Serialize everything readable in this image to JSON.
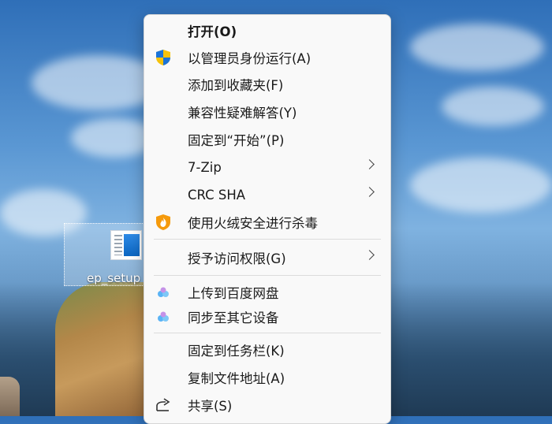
{
  "desktop": {
    "icon_label": "ep_setup"
  },
  "context_menu": {
    "items": [
      {
        "label": "打开(O)",
        "bold": true,
        "icon": null
      },
      {
        "label": "以管理员身份运行(A)",
        "icon": "uac-shield-icon"
      },
      {
        "label": "添加到收藏夹(F)",
        "icon": null
      },
      {
        "label": "兼容性疑难解答(Y)",
        "icon": null
      },
      {
        "label": "固定到“开始”(P)",
        "icon": null
      },
      {
        "label": "7-Zip",
        "icon": null,
        "submenu": true
      },
      {
        "label": "CRC SHA",
        "icon": null,
        "submenu": true
      },
      {
        "label": "使用火绒安全进行杀毒",
        "icon": "huorong-shield-icon"
      },
      {
        "label": "授予访问权限(G)",
        "icon": null,
        "submenu": true
      },
      {
        "label": "上传到百度网盘",
        "icon": "baidu-netdisk-icon"
      },
      {
        "label": "同步至其它设备",
        "icon": "baidu-netdisk-icon"
      },
      {
        "label": "固定到任务栏(K)",
        "icon": null
      },
      {
        "label": "复制文件地址(A)",
        "icon": null
      },
      {
        "label": "共享(S)",
        "icon": "share-icon"
      }
    ]
  },
  "colors": {
    "menu_bg": "#f9f9f9",
    "text": "#1a1a1a",
    "separator": "#dcdcdc"
  }
}
